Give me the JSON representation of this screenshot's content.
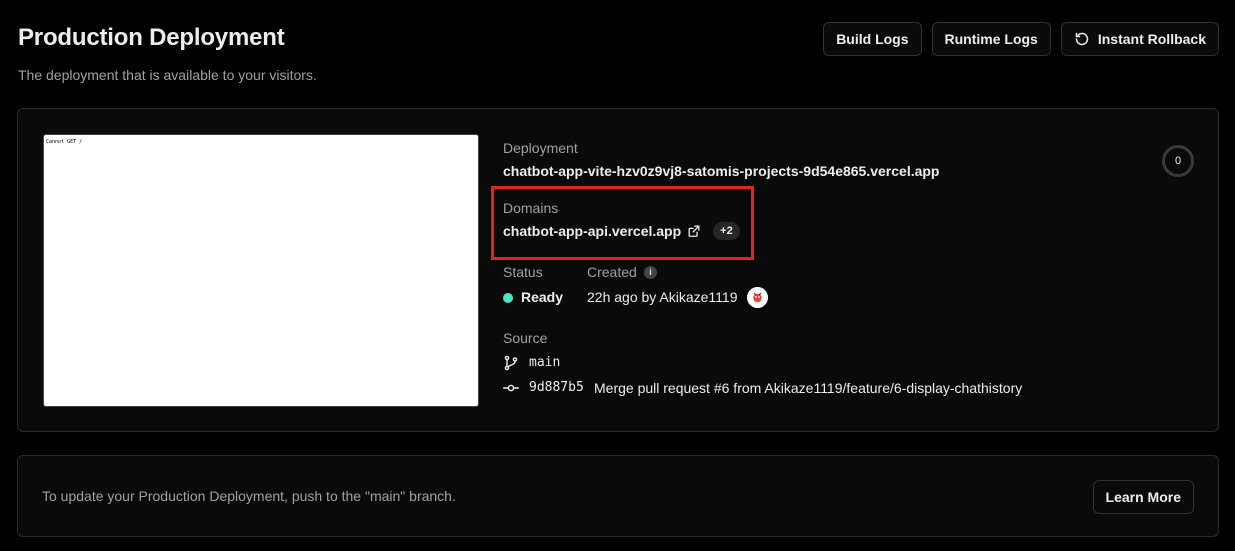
{
  "header": {
    "title": "Production Deployment",
    "subtitle": "The deployment that is available to your visitors."
  },
  "toolbar": {
    "build_logs": "Build Logs",
    "runtime_logs": "Runtime Logs",
    "instant_rollback": "Instant Rollback"
  },
  "preview": {
    "text": "Cannot GET /"
  },
  "deployment": {
    "label": "Deployment",
    "value": "chatbot-app-vite-hzv0z9vj8-satomis-projects-9d54e865.vercel.app"
  },
  "domains": {
    "label": "Domains",
    "primary": "chatbot-app-api.vercel.app",
    "extra_count": "+2"
  },
  "status": {
    "label": "Status",
    "value": "Ready",
    "color": "#50e3c2"
  },
  "created": {
    "label": "Created",
    "info_icon": "i",
    "value": "22h ago by Akikaze1119"
  },
  "source": {
    "label": "Source",
    "branch": "main",
    "commit_hash": "9d887b5",
    "commit_message": "Merge pull request #6 from Akikaze1119/feature/6-display-chathistory"
  },
  "ring_counter": "0",
  "footer": {
    "text": "To update your Production Deployment, push to the \"main\" branch.",
    "learn_more": "Learn More"
  },
  "colors": {
    "highlight": "#e5231b",
    "background": "#000000"
  }
}
